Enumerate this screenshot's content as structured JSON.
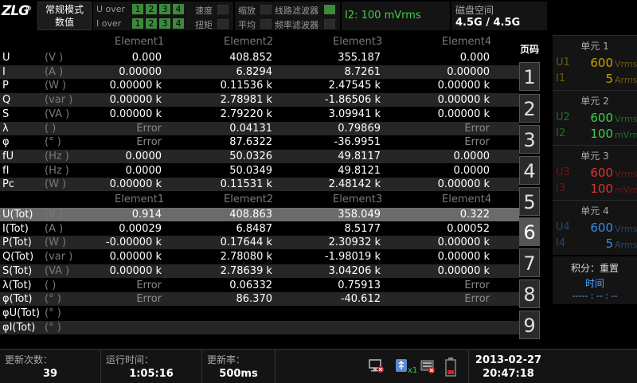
{
  "topbar": {
    "logo_text": "ZLG",
    "logo_reg": "®",
    "mode_line1": "常规模式",
    "mode_line2": "数值",
    "u_over_label": "U over",
    "i_over_label": "I over",
    "over_boxes": [
      "1",
      "2",
      "3",
      "4"
    ],
    "flags": {
      "speed": "速度",
      "scaling": "缩放",
      "line_filter": "线路滤波器",
      "peak": "扭矩",
      "average": "平均",
      "freq_filter": "频率滤波器"
    },
    "range": "I2: 100 mVrms",
    "disk_label": "磁盘空间",
    "disk_value": "4.5G / 4.5G"
  },
  "table": {
    "element_headers": [
      "Element1",
      "Element2",
      "Element3",
      "Element4"
    ],
    "rows1": [
      {
        "name": "U",
        "unit": "(V    )",
        "v": [
          "0.000",
          "408.852",
          "355.187",
          "0.000"
        ],
        "err": [
          false,
          false,
          false,
          false
        ]
      },
      {
        "name": "I",
        "unit": "(A    )",
        "v": [
          "0.00000",
          "6.8294",
          "8.7261",
          "0.00000"
        ],
        "err": [
          false,
          false,
          false,
          false
        ]
      },
      {
        "name": "P",
        "unit": "(W    )",
        "v": [
          "0.00000 k",
          "0.11536 k",
          "2.47545 k",
          "0.00000 k"
        ],
        "err": [
          false,
          false,
          false,
          false
        ]
      },
      {
        "name": "Q",
        "unit": "(var  )",
        "v": [
          "0.00000 k",
          "2.78981 k",
          "-1.86506 k",
          "0.00000 k"
        ],
        "err": [
          false,
          false,
          false,
          false
        ]
      },
      {
        "name": "S",
        "unit": "(VA   )",
        "v": [
          "0.00000 k",
          "2.79220 k",
          "3.09941 k",
          "0.00000 k"
        ],
        "err": [
          false,
          false,
          false,
          false
        ]
      },
      {
        "name": "λ",
        "unit": "(      )",
        "v": [
          "Error",
          "0.04131",
          "0.79869",
          "Error"
        ],
        "err": [
          true,
          false,
          false,
          true
        ]
      },
      {
        "name": "φ",
        "unit": "(°     )",
        "v": [
          "Error",
          "87.6322",
          "-36.9951",
          "Error"
        ],
        "err": [
          true,
          false,
          false,
          true
        ]
      },
      {
        "name": "fU",
        "unit": "(Hz   )",
        "v": [
          "0.0000",
          "50.0326",
          "49.8117",
          "0.0000"
        ],
        "err": [
          false,
          false,
          false,
          false
        ]
      },
      {
        "name": "fI",
        "unit": "(Hz   )",
        "v": [
          "0.0000",
          "50.0349",
          "49.8121",
          "0.0000"
        ],
        "err": [
          false,
          false,
          false,
          false
        ]
      },
      {
        "name": "Pc",
        "unit": "(W    )",
        "v": [
          "0.00000 k",
          "0.11531 k",
          "2.48142 k",
          "0.00000 k"
        ],
        "err": [
          false,
          false,
          false,
          false
        ]
      }
    ],
    "rows2": [
      {
        "name": "U(Tot)",
        "unit": "(V    )",
        "v": [
          "0.914",
          "408.863",
          "358.049",
          "0.322"
        ],
        "err": [
          false,
          false,
          false,
          false
        ]
      },
      {
        "name": "I(Tot)",
        "unit": "(A    )",
        "v": [
          "0.00029",
          "6.8487",
          "8.5177",
          "0.00052"
        ],
        "err": [
          false,
          false,
          false,
          false
        ]
      },
      {
        "name": "P(Tot)",
        "unit": "(W    )",
        "v": [
          "-0.00000 k",
          "0.17644 k",
          "2.30932 k",
          "0.00000 k"
        ],
        "err": [
          false,
          false,
          false,
          false
        ]
      },
      {
        "name": "Q(Tot)",
        "unit": "(var  )",
        "v": [
          "0.00000 k",
          "2.78080 k",
          "-1.98019 k",
          "0.00000 k"
        ],
        "err": [
          false,
          false,
          false,
          false
        ]
      },
      {
        "name": "S(Tot)",
        "unit": "(VA   )",
        "v": [
          "0.00000 k",
          "2.78639 k",
          "3.04206 k",
          "0.00000 k"
        ],
        "err": [
          false,
          false,
          false,
          false
        ]
      },
      {
        "name": "λ(Tot)",
        "unit": "(      )",
        "v": [
          "Error",
          "0.06332",
          "0.75913",
          "Error"
        ],
        "err": [
          true,
          false,
          false,
          true
        ]
      },
      {
        "name": "φ(Tot)",
        "unit": "(°     )",
        "v": [
          "Error",
          "86.370",
          "-40.612",
          "Error"
        ],
        "err": [
          true,
          false,
          false,
          true
        ]
      },
      {
        "name": "φU(Tot)",
        "unit": "(°     )",
        "v": [
          "",
          "",
          "",
          ""
        ],
        "err": [
          false,
          false,
          false,
          false
        ]
      },
      {
        "name": "φI(Tot)",
        "unit": "(°     )",
        "v": [
          "",
          "",
          "",
          ""
        ],
        "err": [
          false,
          false,
          false,
          false
        ]
      }
    ]
  },
  "pages": {
    "label": "页码",
    "items": [
      "1",
      "2",
      "3",
      "4",
      "5",
      "6",
      "7",
      "8",
      "9"
    ],
    "active_index": 5
  },
  "units": [
    {
      "title": "单元 1",
      "u_name": "U1",
      "u_val": "600",
      "u_unit": "Vrms",
      "i_name": "I1",
      "i_val": "5",
      "i_unit": "Arms",
      "u_color": "#c8a000",
      "i_color": "#c8a000",
      "ui_dim": "#6b5a10"
    },
    {
      "title": "单元 2",
      "u_name": "U2",
      "u_val": "600",
      "u_unit": "Vrms",
      "i_name": "I2",
      "i_val": "100",
      "i_unit": "mVrms",
      "u_color": "#3ad24a",
      "i_color": "#3ad24a",
      "ui_dim": "#1f6e28"
    },
    {
      "title": "单元 3",
      "u_name": "U3",
      "u_val": "600",
      "u_unit": "Vrms",
      "i_name": "I3",
      "i_val": "100",
      "i_unit": "mVrms",
      "u_color": "#e03030",
      "i_color": "#e03030",
      "ui_dim": "#6e1818"
    },
    {
      "title": "单元 4",
      "u_name": "U4",
      "u_val": "600",
      "u_unit": "Vrms",
      "i_name": "I4",
      "i_val": "5",
      "i_unit": "Arms",
      "u_color": "#3a8ae0",
      "i_color": "#3a8ae0",
      "ui_dim": "#1e4a78"
    }
  ],
  "integration": {
    "status": "积分：重置",
    "time_label": "时间",
    "time_value": "----- : -- : --"
  },
  "bottombar": {
    "update_count_label": "更新次数：",
    "update_count": "39",
    "run_time_label": "运行时间：",
    "run_time": "1:05:16",
    "update_rate_label": "更新率：",
    "update_rate": "500ms",
    "usb_count": "x1",
    "date": "2013-02-27",
    "time": "20:47:18"
  }
}
